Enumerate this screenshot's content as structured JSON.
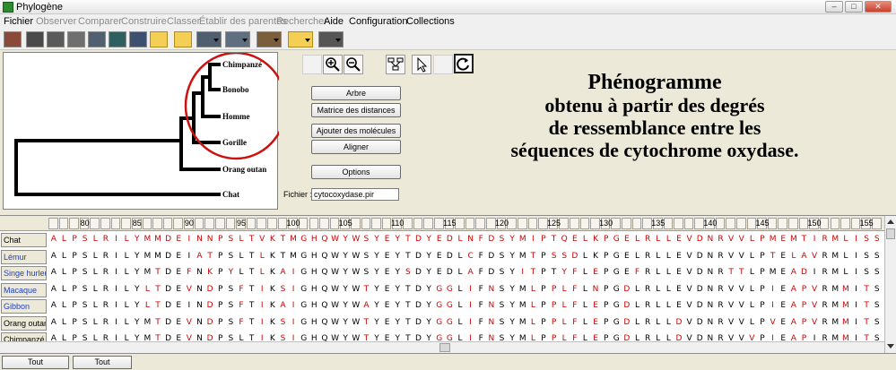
{
  "window": {
    "title": "Phylogène"
  },
  "menu": [
    {
      "label": "Fichier",
      "enabled": true
    },
    {
      "label": "Observer",
      "enabled": false
    },
    {
      "label": "Comparer",
      "enabled": false
    },
    {
      "label": "Construire",
      "enabled": false
    },
    {
      "label": "Classer",
      "enabled": false
    },
    {
      "label": "Établir des parentés",
      "enabled": false
    },
    {
      "label": "Rechercher",
      "enabled": false
    },
    {
      "label": "Aide",
      "enabled": true
    },
    {
      "label": "Configuration",
      "enabled": true
    },
    {
      "label": "Collections",
      "enabled": true
    }
  ],
  "tree": {
    "leaves": [
      "Chimpanzé",
      "Bonobo",
      "Homme",
      "Gorille",
      "Orang outan",
      "Chat"
    ],
    "highlight_color": "#cc1111"
  },
  "buttons": {
    "arbre": "Arbre",
    "matrice": "Matrice des distances",
    "ajouter": "Ajouter des molécules",
    "aligner": "Aligner",
    "options": "Options"
  },
  "file": {
    "label": "Fichier :",
    "value": "cytocoxydase.pir"
  },
  "annotation": {
    "lines": [
      "Phénogramme",
      "obtenu à partir des degrés",
      "de ressemblance entre les",
      "séquences de cytochrome oxydase."
    ]
  },
  "alignment": {
    "ruler_labels": [
      "80",
      "85",
      "90",
      "95",
      "100",
      "105",
      "110",
      "115",
      "120",
      "125",
      "130",
      "135",
      "140",
      "145",
      "150",
      "155"
    ],
    "reference": "Chat",
    "rows": [
      {
        "name": "Chat",
        "seq": "ALPSLRILYMMDEINNPSLTVKTMGHQWYWSYEYTDYEDLNFDSYMIPTQELKPGELRLLEVDNRVVLPMEMTIRMLISS",
        "link": false
      },
      {
        "name": "Lémur",
        "seq": "ALPSLRILYMMDEIATPSLTLKTMGHQWYWSYEYTDYEDLCFDSYMTPSSDLKPGELRLLEVDNRVVLPTELAVRMLISS",
        "link": true
      },
      {
        "name": "Singe hurleur",
        "seq": "ALPSLRILYMTDEFNKPYLTLKAIGHQWYWSYEYSDYEDLAFDSYITPTYFLEPGEFRLLEVDNRTTLPMEADIRMLISS",
        "link": true
      },
      {
        "name": "Macaque",
        "seq": "ALPSLRILYLTDEVNDPSFTIKSIGHQWYWTYEYTDYGGLIFNSYMLPPLFLNPGDLRLLEVDNRVVLPIEAPVRMMITS",
        "link": true
      },
      {
        "name": "Gibbon",
        "seq": "ALPSLRILYLTDEINDPSFTIKAIGHQWYWAYEYTDYGGLIFNSYMLPPLFLEPGDLRLLEVDNRVVLPIEAPVRMMITS",
        "link": true
      },
      {
        "name": "Orang outan",
        "seq": "ALPSLRILYMTDEVNDPSFTIKSIGHQWYWTYEYTDYGGLIFNSYMLPPLFLEPGDLRLLDVDNRVVLPVEAPVRMMITS",
        "link": false
      },
      {
        "name": "Chimpanzé",
        "seq": "ALPSLRILYMTDEVNDPSLTIKSIGHQWYWTYEYTDYGGLIFNSYMLPPLFLEPGDLRLLDVDNRVVVPIEAPIRMMITS",
        "link": false
      }
    ],
    "diff_color": "#cc0000"
  },
  "bottom": {
    "deselect": "Tout désélectionner",
    "select": "Tout sélectionner"
  }
}
